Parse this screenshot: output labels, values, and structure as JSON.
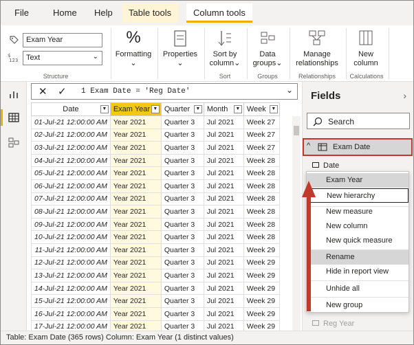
{
  "tabs": [
    "File",
    "Home",
    "Help",
    "Table tools",
    "Column tools"
  ],
  "structure": {
    "name_value": "Exam Year",
    "type_value": "Text",
    "label": "Structure"
  },
  "ribbon": {
    "formatting": "Formatting",
    "properties": "Properties",
    "sort_by_1": "Sort by",
    "sort_by_2": "column",
    "sort_label": "Sort",
    "data_groups_1": "Data",
    "data_groups_2": "groups",
    "groups_label": "Groups",
    "manage_1": "Manage",
    "manage_2": "relationships",
    "relationships_label": "Relationships",
    "new_col_1": "New",
    "new_col_2": "column",
    "calculations_label": "Calculations"
  },
  "formula": {
    "text": "1  Exam Date = 'Reg Date'"
  },
  "grid": {
    "headers": [
      "Date",
      "Exam Year",
      "Quarter",
      "Month",
      "Week"
    ],
    "rows": [
      [
        "01-Jul-21 12:00:00 AM",
        "Year 2021",
        "Quarter 3",
        "Jul 2021",
        "Week 27"
      ],
      [
        "02-Jul-21 12:00:00 AM",
        "Year 2021",
        "Quarter 3",
        "Jul 2021",
        "Week 27"
      ],
      [
        "03-Jul-21 12:00:00 AM",
        "Year 2021",
        "Quarter 3",
        "Jul 2021",
        "Week 27"
      ],
      [
        "04-Jul-21 12:00:00 AM",
        "Year 2021",
        "Quarter 3",
        "Jul 2021",
        "Week 28"
      ],
      [
        "05-Jul-21 12:00:00 AM",
        "Year 2021",
        "Quarter 3",
        "Jul 2021",
        "Week 28"
      ],
      [
        "06-Jul-21 12:00:00 AM",
        "Year 2021",
        "Quarter 3",
        "Jul 2021",
        "Week 28"
      ],
      [
        "07-Jul-21 12:00:00 AM",
        "Year 2021",
        "Quarter 3",
        "Jul 2021",
        "Week 28"
      ],
      [
        "08-Jul-21 12:00:00 AM",
        "Year 2021",
        "Quarter 3",
        "Jul 2021",
        "Week 28"
      ],
      [
        "09-Jul-21 12:00:00 AM",
        "Year 2021",
        "Quarter 3",
        "Jul 2021",
        "Week 28"
      ],
      [
        "10-Jul-21 12:00:00 AM",
        "Year 2021",
        "Quarter 3",
        "Jul 2021",
        "Week 28"
      ],
      [
        "11-Jul-21 12:00:00 AM",
        "Year 2021",
        "Quarter 3",
        "Jul 2021",
        "Week 29"
      ],
      [
        "12-Jul-21 12:00:00 AM",
        "Year 2021",
        "Quarter 3",
        "Jul 2021",
        "Week 29"
      ],
      [
        "13-Jul-21 12:00:00 AM",
        "Year 2021",
        "Quarter 3",
        "Jul 2021",
        "Week 29"
      ],
      [
        "14-Jul-21 12:00:00 AM",
        "Year 2021",
        "Quarter 3",
        "Jul 2021",
        "Week 29"
      ],
      [
        "15-Jul-21 12:00:00 AM",
        "Year 2021",
        "Quarter 3",
        "Jul 2021",
        "Week 29"
      ],
      [
        "16-Jul-21 12:00:00 AM",
        "Year 2021",
        "Quarter 3",
        "Jul 2021",
        "Week 29"
      ],
      [
        "17-Jul-21 12:00:00 AM",
        "Year 2021",
        "Quarter 3",
        "Jul 2021",
        "Week 29"
      ]
    ]
  },
  "fields": {
    "title": "Fields",
    "search_placeholder": "Search",
    "table_name": "Exam Date",
    "items": [
      "Date",
      "Exam Year",
      "Reg Year"
    ]
  },
  "menu": {
    "items": [
      "New hierarchy",
      "New measure",
      "New column",
      "New quick measure",
      "Rename",
      "Hide in report view",
      "Unhide all",
      "New group"
    ]
  },
  "status": {
    "text": "Table: Exam Date (365 rows) Column: Exam Year (1 distinct values)"
  },
  "colors": {
    "accent": "#f2c811",
    "highlight_border": "#c0392b",
    "arrow": "#c0392b"
  }
}
